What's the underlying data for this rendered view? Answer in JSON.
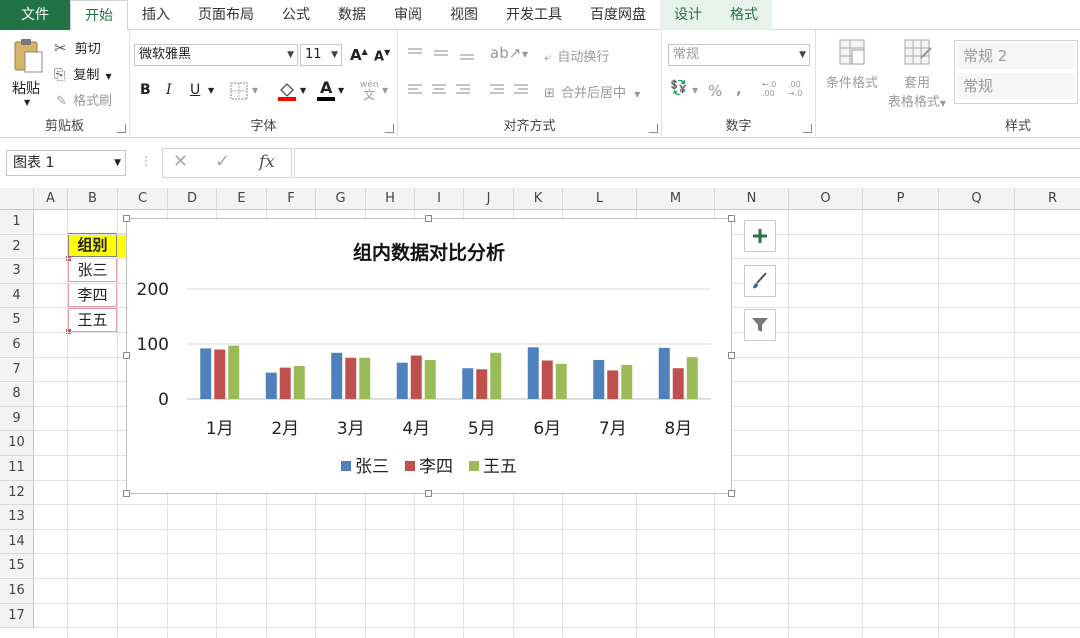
{
  "tabs": [
    "文件",
    "开始",
    "插入",
    "页面布局",
    "公式",
    "数据",
    "审阅",
    "视图",
    "开发工具",
    "百度网盘",
    "设计",
    "格式"
  ],
  "ribbon": {
    "clipboard": {
      "paste": "粘贴",
      "cut": "剪切",
      "copy": "复制",
      "format_painter": "格式刷",
      "label": "剪贴板"
    },
    "font": {
      "name": "微软雅黑",
      "size": "11",
      "grow": "A",
      "shrink": "A",
      "bold": "B",
      "italic": "I",
      "underline": "U",
      "label": "字体",
      "wen": "文",
      "font_color": "A"
    },
    "alignment": {
      "wrap": "自动换行",
      "merge": "合并后居中",
      "label": "对齐方式"
    },
    "number": {
      "format": "常规",
      "percent": "%",
      "comma": ",",
      "inc_decimal": "←.0\n.00",
      "dec_decimal": ".00\n→.0",
      "label": "数字"
    },
    "styles": {
      "conditional": "条件格式",
      "table_line1": "套用",
      "table_line2": "表格格式",
      "style1": "常规 2",
      "style2": "常规",
      "label": "样式"
    }
  },
  "formula_bar": {
    "name_box": "图表 1",
    "fx": "fx"
  },
  "sheet": {
    "columns": [
      "A",
      "B",
      "C",
      "D",
      "E",
      "F",
      "G",
      "H",
      "I",
      "J",
      "K",
      "L",
      "M",
      "N",
      "O",
      "P",
      "Q",
      "R"
    ],
    "rows": [
      "1",
      "2",
      "3",
      "4",
      "5",
      "6",
      "7",
      "8",
      "9",
      "10",
      "11",
      "12",
      "13",
      "14",
      "15",
      "16",
      "17"
    ],
    "cells": {
      "B2": "组别",
      "B3": "张三",
      "B4": "李四",
      "B5": "王五"
    }
  },
  "chart_data": {
    "type": "bar",
    "title": "组内数据对比分析",
    "categories": [
      "1月",
      "2月",
      "3月",
      "4月",
      "5月",
      "6月",
      "7月",
      "8月"
    ],
    "series": [
      {
        "name": "张三",
        "color": "#4f81bd",
        "values": [
          92,
          48,
          84,
          66,
          56,
          94,
          71,
          93
        ]
      },
      {
        "name": "李四",
        "color": "#c0504d",
        "values": [
          90,
          57,
          75,
          79,
          54,
          70,
          52,
          56
        ]
      },
      {
        "name": "王五",
        "color": "#9bbb59",
        "values": [
          97,
          60,
          75,
          71,
          84,
          64,
          62,
          76
        ]
      }
    ],
    "ylim": [
      0,
      200
    ],
    "yticks": [
      "0",
      "100",
      "200"
    ],
    "grid": true,
    "legend": "bottom"
  }
}
